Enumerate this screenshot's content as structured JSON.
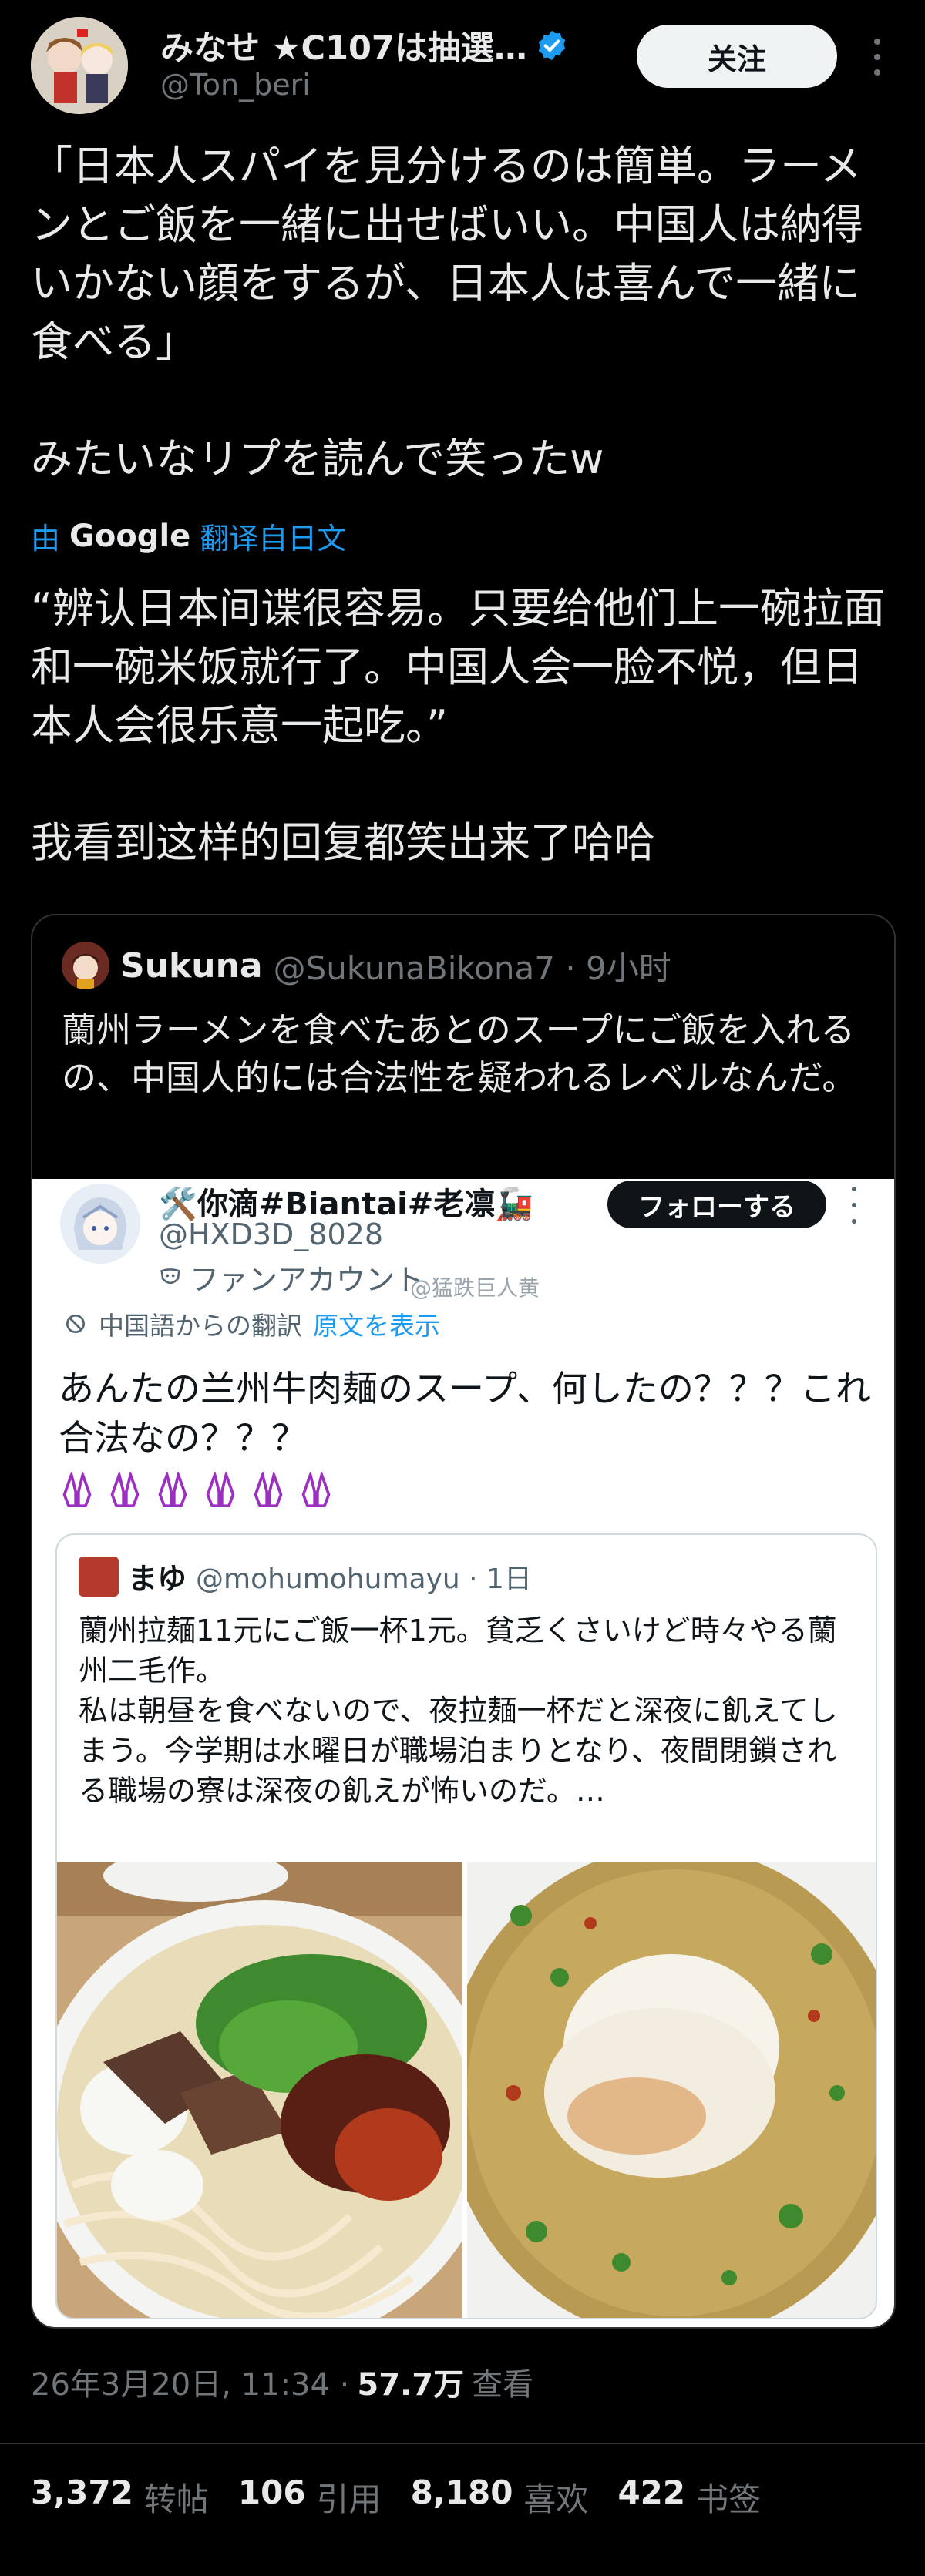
{
  "author": {
    "name": "みなせ ★C107は抽選…",
    "handle": "@Ton_beri",
    "follow_label": "关注"
  },
  "tweet": {
    "text": "「日本人スパイを見分けるのは簡単。ラーメンとご飯を一緒に出せばいい。中国人は納得いかない顔をするが、日本人は喜んで一緒に食べる」\n\nみたいなリプを読んで笑ったw",
    "translate_prefix": "由",
    "translate_brand": "Google",
    "translate_suffix": "翻译自日文",
    "translated_text": "“辨认日本间谍很容易。只要给他们上一碗拉面和一碗米饭就行了。中国人会一脸不悦，但日本人会很乐意一起吃。”\n\n我看到这样的回复都笑出来了哈哈"
  },
  "quote": {
    "name": "Sukuna",
    "handle": "@SukunaBikona7 · 9小时",
    "text": "蘭州ラーメンを食べたあとのスープにご飯を入れるの、中国人的には合法性を疑われるレベルなんだ。",
    "embedded": {
      "name": "🛠️你滴#Biantai#老凛🚂",
      "handle": "@HXD3D_8028",
      "fan_label": "ファンアカウント",
      "follow_label": "フォローする",
      "watermark": "@猛跌巨人黄",
      "translation_note": "中国語からの翻訳",
      "show_original": "原文を表示",
      "text": "あんたの兰州牛肉麺のスープ、何したの？？？これ合法なの？？？",
      "inner": {
        "name": "まゆ",
        "handle": "@mohumohumayu · 1日",
        "text": "蘭州拉麺11元にご飯一杯1元。貧乏くさいけど時々やる蘭州二毛作。\n私は朝昼を食べないので、夜拉麺一杯だと深夜に飢えてしまう。今学期は水曜日が職場泊まりとなり、夜間閉鎖される職場の寮は深夜の飢えが怖いのだ。…"
      }
    }
  },
  "footer": {
    "datetime": "26年3月20日, 11:34 ·",
    "views_count": "57.7万",
    "views_label": "查看",
    "stats": [
      {
        "num": "3,372",
        "label": "转帖"
      },
      {
        "num": "106",
        "label": "引用"
      },
      {
        "num": "8,180",
        "label": "喜欢"
      },
      {
        "num": "422",
        "label": "书签"
      }
    ]
  },
  "colors": {
    "background": "#000000",
    "text": "#e7e9ea",
    "secondary": "#71767b",
    "link": "#1d9bf0",
    "verified": "#1d9bf0"
  }
}
